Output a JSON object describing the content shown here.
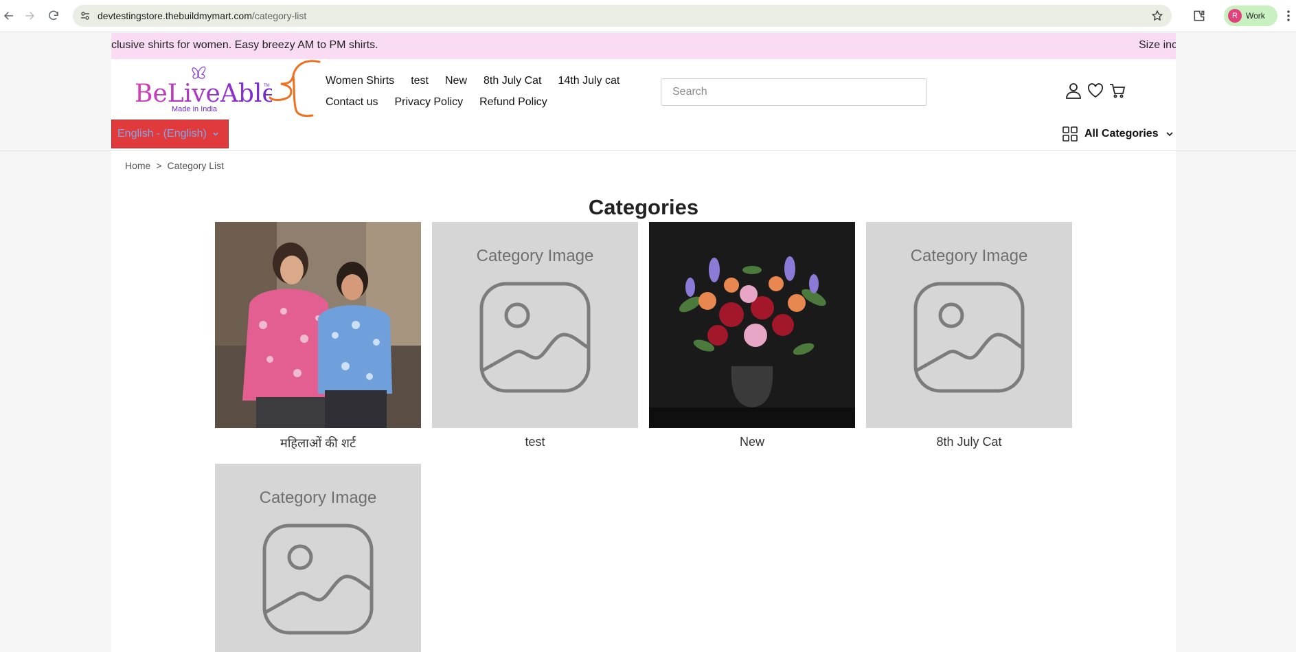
{
  "browser": {
    "url_host": "devtestingstore.thebuildmymart.com",
    "url_path": "/category-list",
    "profile_initial": "R",
    "profile_name": "Work"
  },
  "announcement": {
    "text_left": "clusive shirts for women. Easy breezy AM to PM shirts.",
    "text_right": "Size inc"
  },
  "logo": {
    "wordmark": "BeLiveAble",
    "tagline": "Made in India",
    "mark": "TM"
  },
  "menu": {
    "row1": [
      "Women Shirts",
      "test",
      "New",
      "8th July Cat",
      "14th July cat"
    ],
    "row2": [
      "Contact us",
      "Privacy Policy",
      "Refund Policy"
    ]
  },
  "search": {
    "placeholder": "Search"
  },
  "icons": {
    "account": "user-icon",
    "wishlist": "heart-icon",
    "cart": "cart-icon"
  },
  "language": {
    "label": "English - (English)"
  },
  "all_categories": {
    "label": "All Categories"
  },
  "breadcrumb": {
    "home": "Home",
    "separator": ">",
    "current": "Category List"
  },
  "page": {
    "title": "Categories"
  },
  "categories": [
    {
      "name": "महिलाओं की शर्ट",
      "image": "photo-women-shirts"
    },
    {
      "name": "test",
      "image": "placeholder",
      "placeholder_text": "Category Image"
    },
    {
      "name": "New",
      "image": "photo-flowers"
    },
    {
      "name": "8th July Cat",
      "image": "placeholder",
      "placeholder_text": "Category Image"
    },
    {
      "name": "",
      "image": "placeholder",
      "placeholder_text": "Category Image"
    }
  ],
  "colors": {
    "announcement_bg": "#f9dcf4",
    "language_bg": "#e03a3c",
    "language_text": "#7fa8e8",
    "placeholder_bg": "#d6d6d6",
    "accent_orange": "#f07020"
  }
}
